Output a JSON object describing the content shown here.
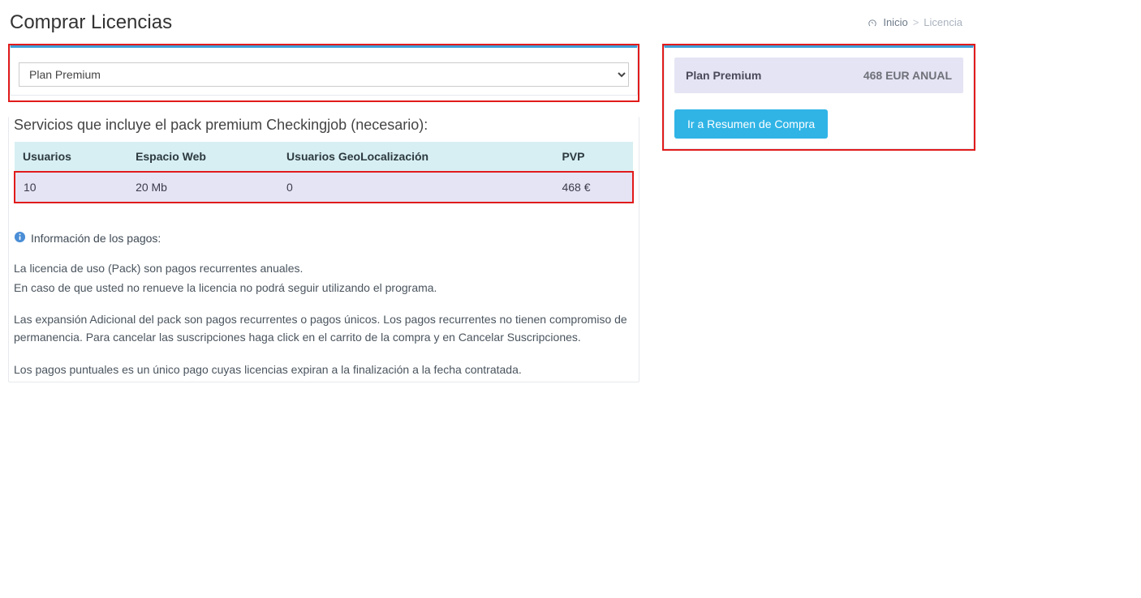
{
  "page_title": "Comprar Licencias",
  "breadcrumb": {
    "home": "Inicio",
    "current": "Licencia"
  },
  "plan_select": {
    "value": "Plan Premium"
  },
  "subheading": "Servicios que incluye el pack premium Checkingjob (necesario):",
  "services": {
    "headers": {
      "usuarios": "Usuarios",
      "espacio": "Espacio Web",
      "geo": "Usuarios GeoLocalización",
      "pvp": "PVP"
    },
    "row": {
      "usuarios": "10",
      "espacio": "20 Mb",
      "geo": "0",
      "pvp": "468 €"
    }
  },
  "info": {
    "heading": "Información de los pagos:",
    "p1": "La licencia de uso (Pack) son pagos recurrentes anuales.",
    "p2": "En caso de que usted no renueve la licencia no podrá seguir utilizando el programa.",
    "p3": "Las expansión Adicional del pack son pagos recurrentes o pagos únicos. Los pagos recurrentes no tienen compromiso de permanencia. Para cancelar las suscripciones haga click en el carrito de la compra y en Cancelar Suscripciones.",
    "p4": "Los pagos puntuales es un único pago cuyas licencias expiran a la finalización a la fecha contratada."
  },
  "summary": {
    "plan_name": "Plan Premium",
    "price": "468 EUR ANUAL",
    "button": "Ir a Resumen de Compra"
  }
}
